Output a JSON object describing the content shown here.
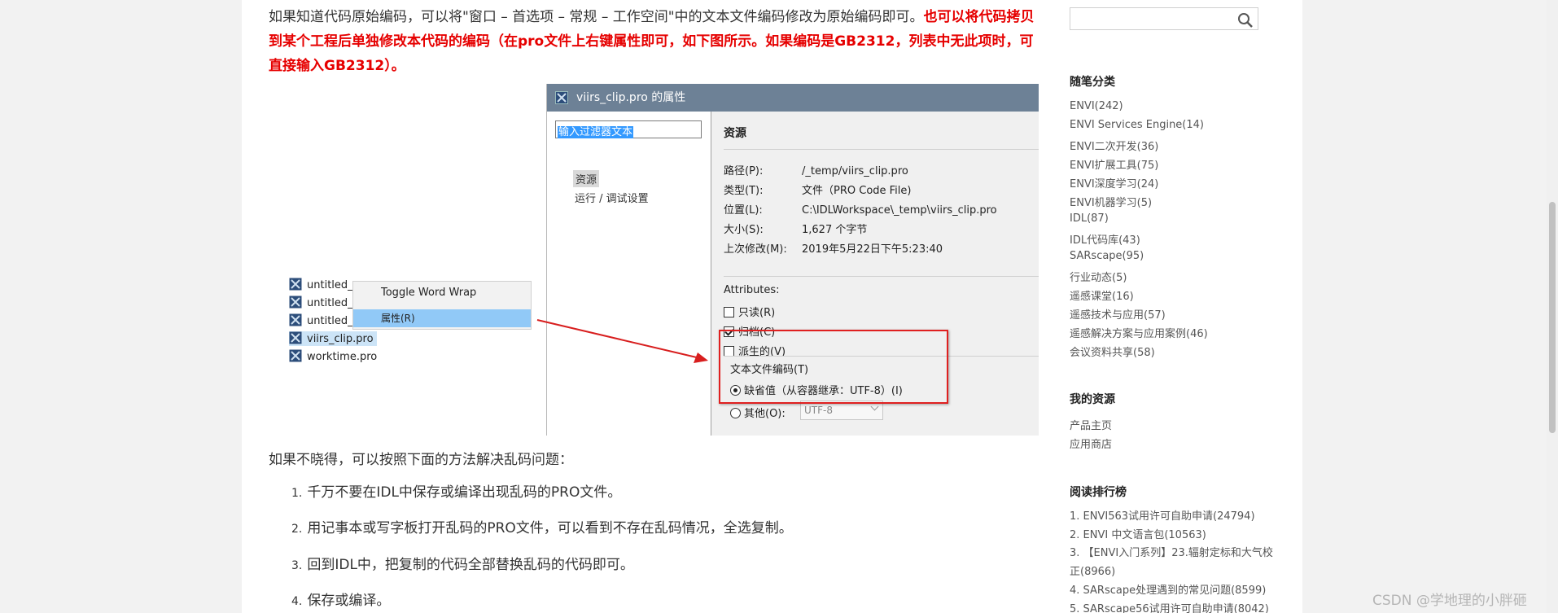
{
  "article": {
    "intro_text": "如果知道代码原始编码，可以将\"窗口 – 首选项 – 常规 – 工作空间\"中的文本文件编码修改为原始编码即可。",
    "intro_highlight": "也可以将代码拷贝到某个工程后单独修改本代码的编码（在pro文件上右键属性即可，如下图所示。如果编码是GB2312，列表中无此项时，可直接输入GB2312）。",
    "para2": "如果不晓得，可以按照下面的方法解决乱码问题：",
    "steps": [
      {
        "n": "1.",
        "text": "千万不要在IDL中保存或编译出现乱码的PRO文件。"
      },
      {
        "n": "2.",
        "text": "用记事本或写字板打开乱码的PRO文件，可以看到不存在乱码情况，全选复制。"
      },
      {
        "n": "3.",
        "text": "回到IDL中，把复制的代码全部替换乱码的代码即可。"
      },
      {
        "n": "4.",
        "text": "保存或编译。"
      }
    ]
  },
  "dialog": {
    "title": "viirs_clip.pro 的属性",
    "filter_text": "输入过滤器文本",
    "tree": [
      "资源",
      "运行 / 调试设置"
    ],
    "section_title": "资源",
    "props": [
      {
        "k": "路径(P):",
        "v": "/_temp/viirs_clip.pro"
      },
      {
        "k": "类型(T):",
        "v": "文件（PRO Code File)"
      },
      {
        "k": "位置(L):",
        "v": "C:\\IDLWorkspace\\_temp\\viirs_clip.pro"
      },
      {
        "k": "大小(S):",
        "v": "1,627 个字节"
      },
      {
        "k": "上次修改(M):",
        "v": "2019年5月22日下午5:23:40"
      }
    ],
    "attributes_label": "Attributes:",
    "attributes": [
      {
        "label": "只读(R)",
        "checked": false
      },
      {
        "label": "归档(C)",
        "checked": true
      },
      {
        "label": "派生的(V)",
        "checked": false
      }
    ],
    "encoding_title": "文本文件编码(T)",
    "default_option": "缺省值（从容器继承：UTF-8）(I)",
    "other_option": "其他(O):",
    "other_value": "UTF-8"
  },
  "project_list": {
    "items": [
      "untitled_",
      "untitled_",
      "untitled_",
      "viirs_clip.pro",
      "worktime.pro"
    ],
    "menu": [
      "Toggle Word Wrap",
      "属性(R)"
    ]
  },
  "sidebar": {
    "categories_title": "随笔分类",
    "categories": [
      "ENVI(242)",
      "ENVI Services Engine(14)",
      "ENVI二次开发(36)",
      "ENVI扩展工具(75)",
      "ENVI深度学习(24)",
      "ENVI机器学习(5)",
      "IDL(87)",
      "IDL代码库(43)",
      "SARscape(95)",
      "行业动态(5)",
      "遥感课堂(16)",
      "遥感技术与应用(57)",
      "遥感解决方案与应用案例(46)",
      "会议资料共享(58)"
    ],
    "resources_title": "我的资源",
    "resources": [
      "产品主页",
      "应用商店"
    ],
    "ranking_title": "阅读排行榜",
    "ranking": [
      "1. ENVI563试用许可自助申请(24794)",
      "2. ENVI 中文语言包(10563)",
      "3. 【ENVI入门系列】23.辐射定标和大气校正(8966)",
      "4. SARscape处理遇到的常见问题(8599)",
      "5. SARscape56试用许可自助申请(8042)"
    ]
  },
  "watermark": "CSDN @学地理的小胖砸"
}
